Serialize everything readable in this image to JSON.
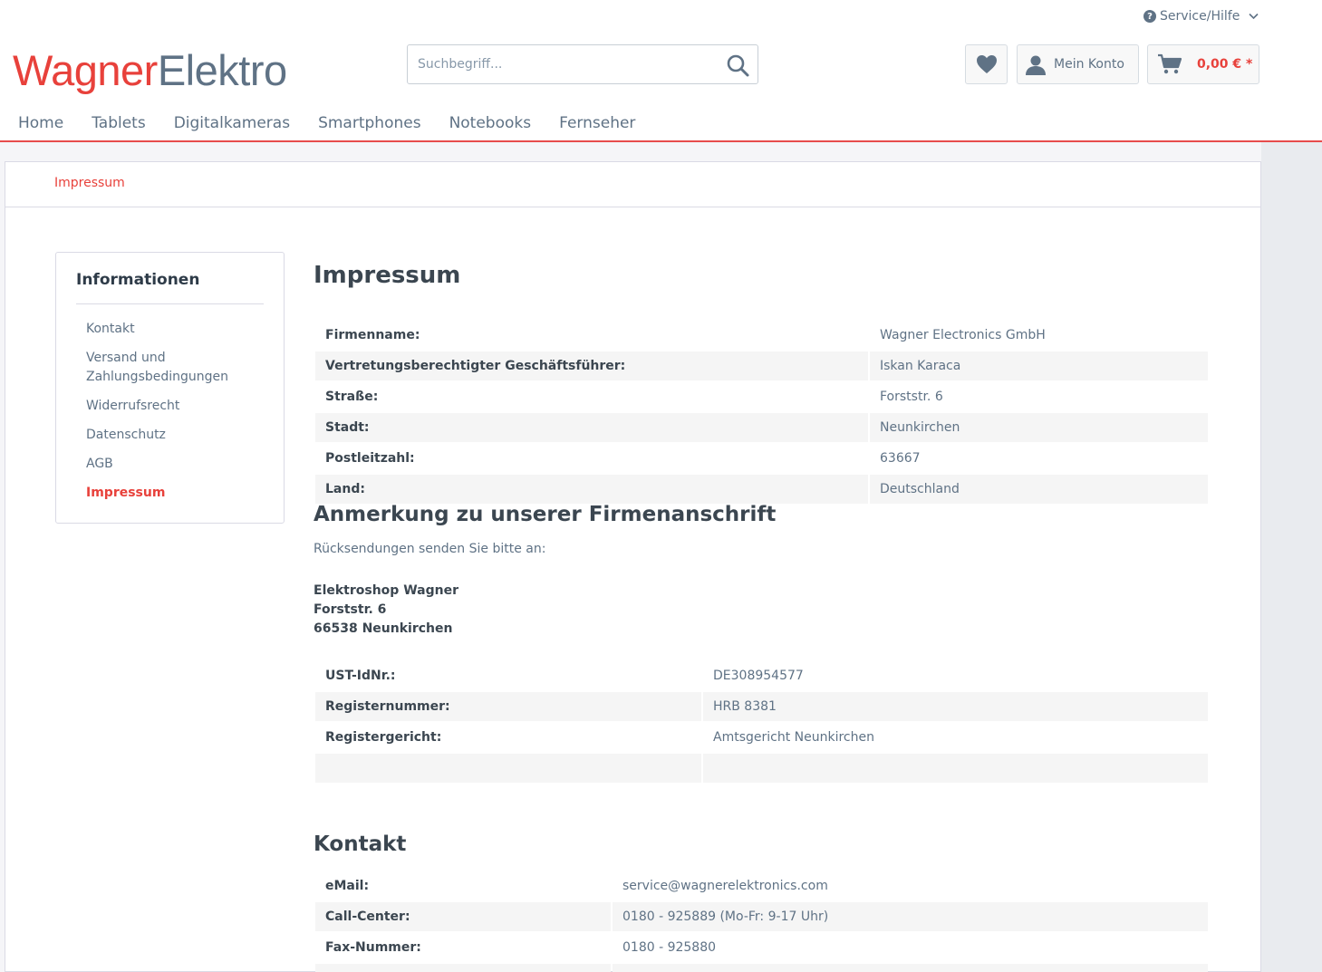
{
  "header": {
    "service_label": "Service/Hilfe",
    "logo_part1": "Wagner",
    "logo_part2": "Elektro",
    "search_placeholder": "Suchbegriff...",
    "account_label": "Mein Konto",
    "cart_label": "0,00 € *"
  },
  "nav": [
    "Home",
    "Tablets",
    "Digitalkameras",
    "Smartphones",
    "Notebooks",
    "Fernseher"
  ],
  "breadcrumb": "Impressum",
  "sidebar": {
    "title": "Informationen",
    "items": [
      "Kontakt",
      "Versand und Zahlungsbedingungen",
      "Widerrufsrecht",
      "Datenschutz",
      "AGB",
      "Impressum"
    ],
    "active_index": 5
  },
  "main": {
    "title": "Impressum",
    "company_table": [
      {
        "k": "Firmenname:",
        "v": "Wagner Electronics GmbH"
      },
      {
        "k": "Vertretungsberechtigter Geschäftsführer:",
        "v": "Iskan Karaca"
      },
      {
        "k": "Straße:",
        "v": "Forststr. 6"
      },
      {
        "k": "Stadt:",
        "v": "Neunkirchen"
      },
      {
        "k": "Postleitzahl:",
        "v": "63667"
      },
      {
        "k": "Land:",
        "v": "Deutschland"
      }
    ],
    "note_title": "Anmerkung zu unserer Firmenanschrift",
    "note_text": "Rücksendungen senden Sie bitte an:",
    "return_address": [
      "Elektroshop Wagner",
      "Forststr. 6",
      "66538 Neunkirchen"
    ],
    "register_table": [
      {
        "k": "UST-IdNr.:",
        "v": "DE308954577"
      },
      {
        "k": "Registernummer:",
        "v": "HRB 8381"
      },
      {
        "k": "Registergericht:",
        "v": "Amtsgericht Neunkirchen"
      },
      {
        "k": "",
        "v": ""
      }
    ],
    "contact_title": "Kontakt",
    "contact_table": [
      {
        "k": "eMail:",
        "v": "service@wagnerelektronics.com"
      },
      {
        "k": "Call-Center:",
        "v": "0180 - 925889   (Mo-Fr: 9-17 Uhr)"
      },
      {
        "k": "Fax-Nummer:",
        "v": "0180 - 925880"
      },
      {
        "k": "",
        "v": ""
      }
    ]
  }
}
